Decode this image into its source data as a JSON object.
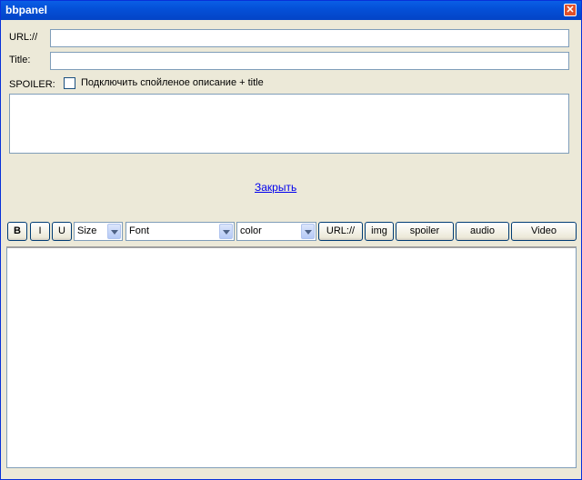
{
  "window": {
    "title": "bbpanel",
    "close_glyph": "✕"
  },
  "form": {
    "url_label": "URL://",
    "url_value": "",
    "title_label": "Title:",
    "title_value": "",
    "spoiler_label": "SPOILER:",
    "spoiler_checkbox_label": "Подключить спойленое описание + title",
    "spoiler_checked": false,
    "spoiler_text": ""
  },
  "close_link": "Закрыть",
  "toolbar": {
    "bold": "B",
    "italic": "I",
    "underline": "U",
    "size_select": "Size",
    "font_select": "Font",
    "color_select": "color",
    "url_button": "URL://",
    "img_button": "img",
    "spoiler_button": "spoiler",
    "audio_button": "audio",
    "video_button": "Video"
  },
  "editor": {
    "content": ""
  }
}
